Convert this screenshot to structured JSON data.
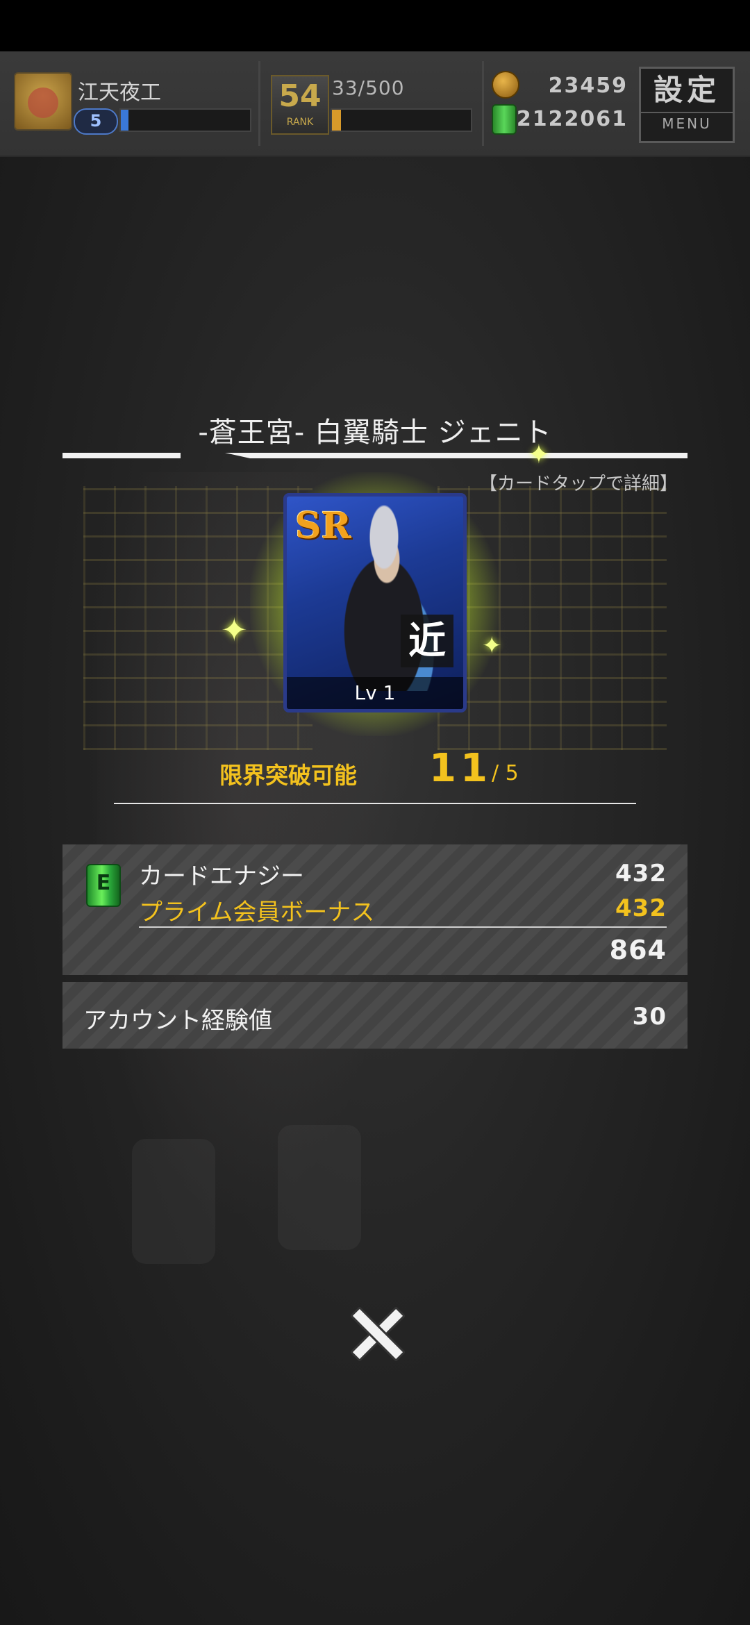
{
  "header": {
    "username": "江天夜工",
    "player_level": "5",
    "exp_progress": 0.06,
    "rank": "54",
    "rank_label": "RANK",
    "stamina": "33/500",
    "stamina_progress": 0.066,
    "coins": "23459",
    "energy": "2122061",
    "settings_label": "設定",
    "menu_label": "MENU"
  },
  "result": {
    "card_name": "-蒼王宮- 白翼騎士 ジェニト",
    "detail_hint": "【カードタップで詳細】",
    "rarity": "SR",
    "type": "近",
    "level": "Lv 1",
    "limit_break_label": "限界突破可能",
    "limit_break_count": "11",
    "limit_break_max": "/ 5"
  },
  "rewards": {
    "card_energy_label": "カードエナジー",
    "card_energy_value": "432",
    "prime_bonus_label": "プライム会員ボーナス",
    "prime_bonus_value": "432",
    "energy_total": "864",
    "account_exp_label": "アカウント経験値",
    "account_exp_value": "30"
  },
  "colors": {
    "accent_gold": "#f3c21e",
    "exp_bar": "#3a78d8",
    "stamina_bar": "#d89a2a",
    "glow": "#e0ff40"
  },
  "icons": {
    "close": "close-icon",
    "coin": "coin-icon",
    "energy": "energy-can-icon"
  }
}
